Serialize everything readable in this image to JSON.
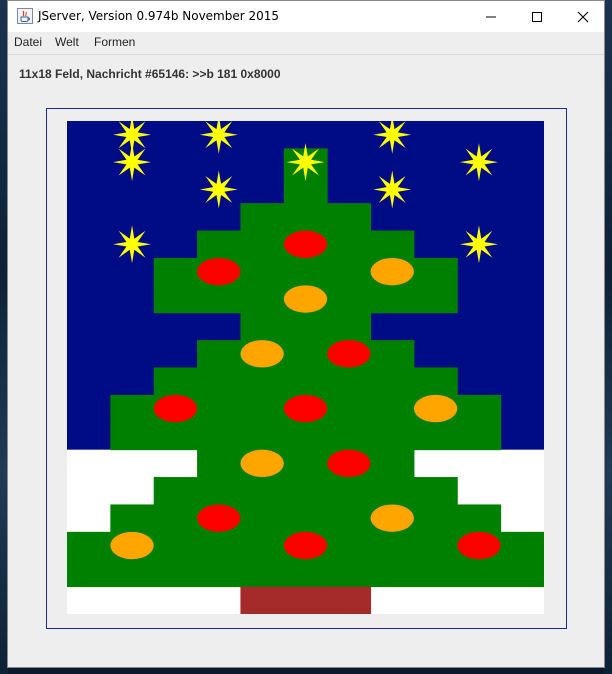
{
  "window": {
    "title": "JServer, Version 0.974b November 2015"
  },
  "menu": {
    "items": [
      "Datei",
      "Welt",
      "Formen"
    ]
  },
  "status": {
    "text": "11x18 Feld, Nachricht #65146: >>b 181 0x8000"
  },
  "colors": {
    "sky": "#000c86",
    "tree": "#008000",
    "snow": "#ffffff",
    "trunk": "#a52a2a",
    "red": "#ff0000",
    "orange": "#ffa500",
    "star": "#ffff00"
  },
  "icons": [
    "java-icon",
    "minimize-icon",
    "maximize-icon",
    "close-icon"
  ],
  "field": {
    "cols": 11,
    "rows": 18,
    "bg_rows": [
      "BBBBBBBBBBB",
      "BBBBBBBBBBB",
      "BBBBBBBBBBB",
      "BBBBBBBBBBB",
      "BBBBBBBBBBB",
      "BBBBBBBBBBB",
      "BBBBBBBBBBB",
      "BBBBBBBBBBB",
      "BBBBBBBBBBB",
      "BBBBBBBBBBB",
      "BBBBBBBBBBB",
      "BBBBBBBBBBB",
      "WWWWWWWWWWW",
      "WWWWWWWWWWW",
      "WWWWWWWWWWW",
      "WWWWWWWWWWW",
      "WWWWWWWWWWW",
      "WWWWWWWWWWW"
    ],
    "tree_rows": [
      "...........",
      ".....X.....",
      ".....X.....",
      "....XXX....",
      "...XXXXX...",
      "..XXXXXXX..",
      "..XXXXXXX..",
      "....XXX....",
      "...XXXXX...",
      "..XXXXXXX..",
      ".XXXXXXXXX.",
      ".XXXXXXXXX.",
      "...XXXXX...",
      "..XXXXXXX..",
      ".XXXXXXXXX.",
      "XXXXXXXXXXX",
      "XXXXXXXXXXX",
      "....TTT...."
    ],
    "ornaments": [
      {
        "col": 1,
        "row": 0,
        "kind": "star"
      },
      {
        "col": 3,
        "row": 0,
        "kind": "star"
      },
      {
        "col": 7,
        "row": 0,
        "kind": "star"
      },
      {
        "col": 9,
        "row": 1,
        "kind": "star"
      },
      {
        "col": 1,
        "row": 1,
        "kind": "star"
      },
      {
        "col": 5,
        "row": 1,
        "kind": "star"
      },
      {
        "col": 3,
        "row": 2,
        "kind": "star"
      },
      {
        "col": 7,
        "row": 2,
        "kind": "star"
      },
      {
        "col": 1,
        "row": 4,
        "kind": "star"
      },
      {
        "col": 9,
        "row": 4,
        "kind": "star"
      },
      {
        "col": 5,
        "row": 4,
        "kind": "red"
      },
      {
        "col": 3,
        "row": 5,
        "kind": "red"
      },
      {
        "col": 7,
        "row": 5,
        "kind": "orange"
      },
      {
        "col": 5,
        "row": 6,
        "kind": "orange"
      },
      {
        "col": 4,
        "row": 8,
        "kind": "orange"
      },
      {
        "col": 6,
        "row": 8,
        "kind": "red"
      },
      {
        "col": 2,
        "row": 10,
        "kind": "red"
      },
      {
        "col": 5,
        "row": 10,
        "kind": "red"
      },
      {
        "col": 8,
        "row": 10,
        "kind": "orange"
      },
      {
        "col": 4,
        "row": 12,
        "kind": "orange"
      },
      {
        "col": 6,
        "row": 12,
        "kind": "red"
      },
      {
        "col": 3,
        "row": 14,
        "kind": "red"
      },
      {
        "col": 7,
        "row": 14,
        "kind": "orange"
      },
      {
        "col": 1,
        "row": 15,
        "kind": "orange"
      },
      {
        "col": 5,
        "row": 15,
        "kind": "red"
      },
      {
        "col": 9,
        "row": 15,
        "kind": "red"
      }
    ]
  }
}
